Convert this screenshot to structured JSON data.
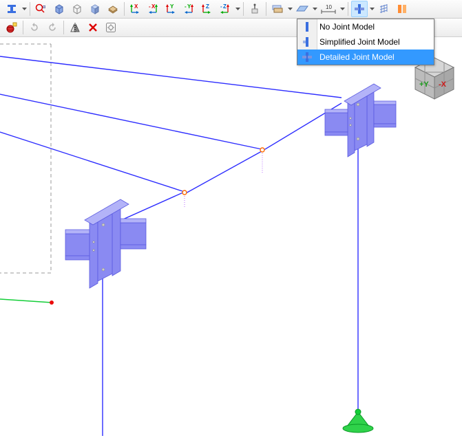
{
  "toolbar1": {
    "btn1": "section-ipe",
    "btn2": "dropdown",
    "btn3": "search-alpha",
    "btn4": "cube-blue",
    "btn5": "cube-hollow",
    "btn6": "cube-face",
    "btn7": "deck",
    "btn8": "axis-x-plus",
    "btn9": "axis-x-minus",
    "btn10": "axis-y-plus",
    "btn11": "axis-y-minus",
    "btn12": "axis-z-plus",
    "btn13": "axis-z-minus",
    "btn14": "probe",
    "btn15": "layers",
    "btn16": "plane",
    "btn17": "measure-10",
    "measure_label": "10",
    "btn18": "joint-model",
    "btn19": "grid-3d",
    "btn20": "orange-blocks",
    "x_label": "X",
    "y_label": "Y",
    "z_label": "Z"
  },
  "toolbar2": {
    "btn1": "global-load",
    "btn2": "refresh-select",
    "btn3": "loop-select",
    "btn4": "mirror",
    "btn5": "delete",
    "btn6": "settings"
  },
  "menu": {
    "items": [
      {
        "label": "No Joint Model",
        "selected": false
      },
      {
        "label": "Simplified Joint Model",
        "selected": false
      },
      {
        "label": "Detailed Joint Model",
        "selected": true
      }
    ]
  },
  "axis_cube": {
    "y_label": "+Y",
    "x_label": "-X"
  },
  "colors": {
    "accent": "#3399ff",
    "frame": "#2e2eff",
    "node": "#ea0b0b",
    "ground": "#12ce37"
  }
}
